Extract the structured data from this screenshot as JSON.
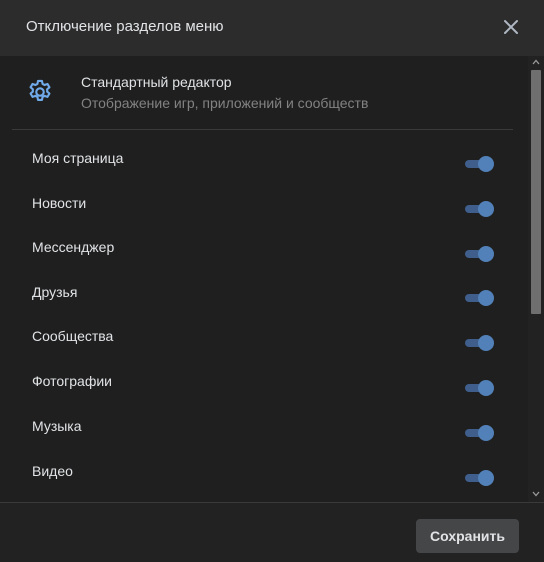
{
  "dialog": {
    "title": "Отключение разделов меню",
    "close_icon": "close-icon"
  },
  "editor": {
    "icon": "gear-icon",
    "title": "Стандартный редактор",
    "subtitle": "Отображение игр, приложений и сообществ"
  },
  "menu_items": [
    {
      "label": "Моя страница",
      "enabled": true
    },
    {
      "label": "Новости",
      "enabled": true
    },
    {
      "label": "Мессенджер",
      "enabled": true
    },
    {
      "label": "Друзья",
      "enabled": true
    },
    {
      "label": "Сообщества",
      "enabled": true
    },
    {
      "label": "Фотографии",
      "enabled": true
    },
    {
      "label": "Музыка",
      "enabled": true
    },
    {
      "label": "Видео",
      "enabled": true
    }
  ],
  "footer": {
    "save_label": "Сохранить"
  },
  "colors": {
    "accent": "#5181b8",
    "toggle_track": "#3f5e8c",
    "background": "#222222",
    "header": "#2c2c2c",
    "button": "#454647"
  }
}
